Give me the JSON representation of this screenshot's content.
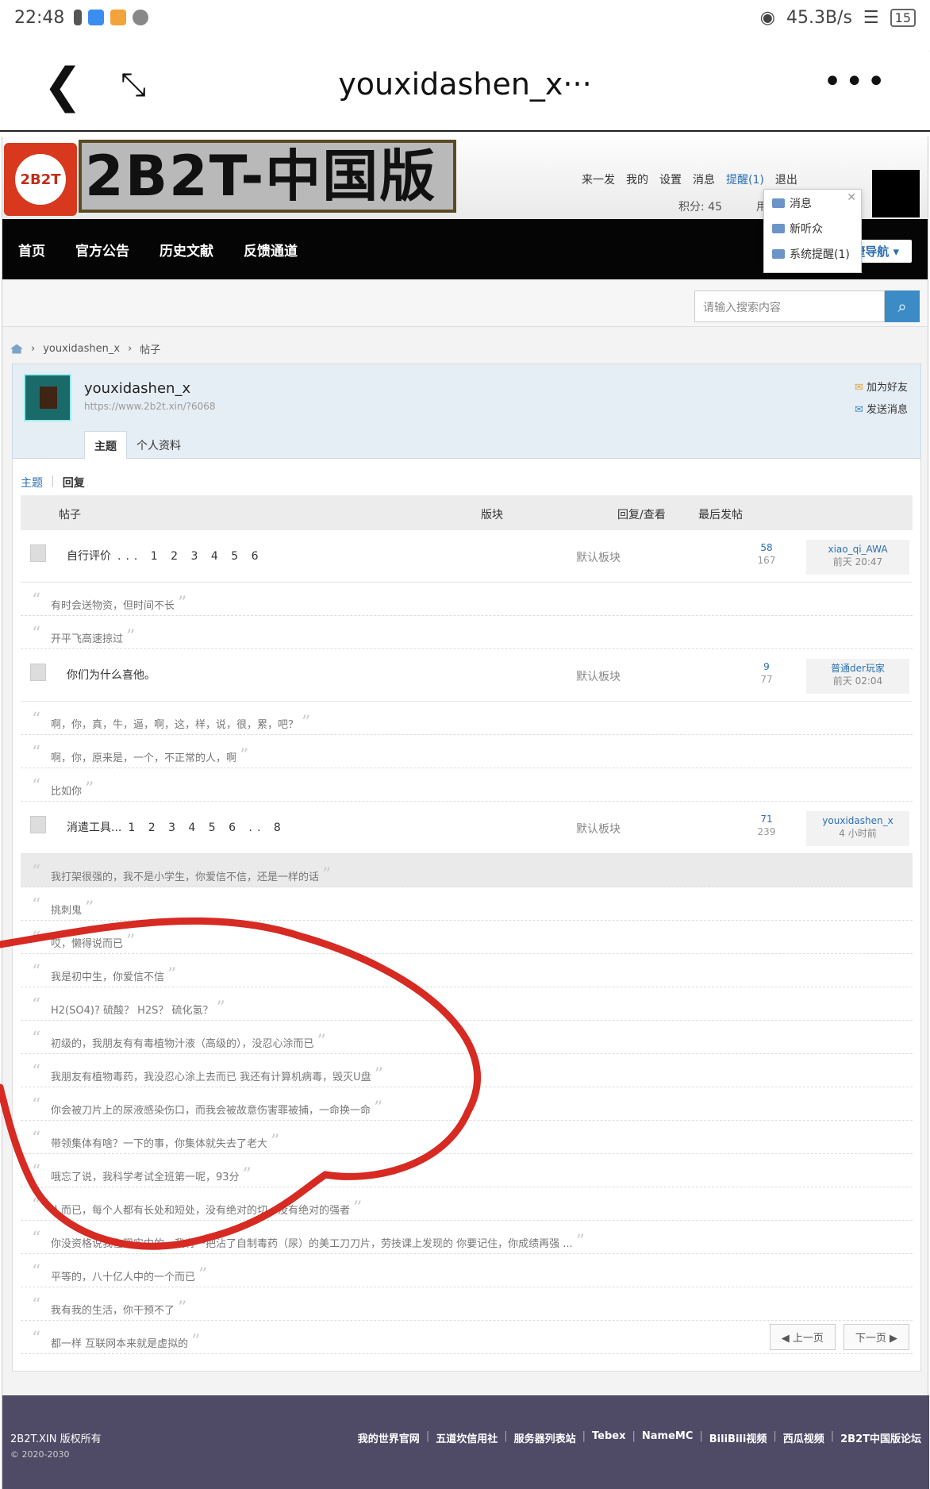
{
  "status": {
    "time": "22:48",
    "speed": "45.3B/s",
    "battery": "15"
  },
  "app": {
    "title": "youxidashen_x···"
  },
  "site": {
    "logo_badge": "2B2T",
    "logo_text": "2B2T-中国版",
    "user_links": [
      "来一发",
      "我的",
      "设置",
      "消息",
      "提醒(1)",
      "退出"
    ],
    "points": "积分: 45",
    "points_extra": "用"
  },
  "popup": {
    "items": [
      "消息",
      "新听众",
      "系统提醒(1)"
    ]
  },
  "nav": {
    "items": [
      "首页",
      "官方公告",
      "历史文献",
      "反馈通道"
    ],
    "fast_nav": "快捷导航"
  },
  "search": {
    "placeholder": "请输入搜索内容"
  },
  "breadcrumb": {
    "user": "youxidashen_x",
    "page": "帖子"
  },
  "profile": {
    "name": "youxidashen_x",
    "url": "https://www.2b2t.xin/?6068",
    "add_friend": "加为好友",
    "send_msg": "发送消息",
    "tabs": [
      "主题",
      "个人资料"
    ]
  },
  "subtabs": [
    "主题",
    "回复"
  ],
  "table_head": {
    "post": "帖子",
    "forum": "版块",
    "stats": "回复/查看",
    "last": "最后发帖"
  },
  "rows": [
    {
      "kind": "thread",
      "title": "自行评价",
      "pages": "... 1 2 3 4 5 6",
      "forum": "默认板块",
      "replies": "58",
      "views": "167",
      "last_user": "xiao_qi_AWA",
      "last_time": "前天 20:47"
    },
    {
      "kind": "reply",
      "text": "有时会送物资，但时间不长"
    },
    {
      "kind": "reply",
      "text": "开平飞高速掠过"
    },
    {
      "kind": "thread",
      "title": "你们为什么喜他。",
      "pages": "",
      "forum": "默认板块",
      "replies": "9",
      "views": "77",
      "last_user": "普通der玩家",
      "last_time": "前天 02:04"
    },
    {
      "kind": "reply",
      "text": "啊，你，真，牛，逼，啊，这，样，说，很，累，吧？"
    },
    {
      "kind": "reply",
      "text": "啊，你，原来是，一个，不正常的人，啊"
    },
    {
      "kind": "reply",
      "text": "比如你"
    },
    {
      "kind": "thread",
      "title": "消遣工具...",
      "pages": "1 2 3 4 5 6 .. 8",
      "forum": "默认板块",
      "replies": "71",
      "views": "239",
      "last_user": "youxidashen_x",
      "last_time": "4 小时前"
    },
    {
      "kind": "reply",
      "text": "我打架很强的，我不是小学生，你爱信不信，还是一样的话",
      "highlight": true
    },
    {
      "kind": "reply",
      "text": "挑刺鬼"
    },
    {
      "kind": "reply",
      "text": "哎，懒得说而已"
    },
    {
      "kind": "reply",
      "text": "我是初中生，你爱信不信"
    },
    {
      "kind": "reply",
      "text": "H2(SO4)? 硫酸？ H2S？ 硫化氢？"
    },
    {
      "kind": "reply",
      "text": "初级的，我朋友有有毒植物汁液（高级的），没忍心涂而已"
    },
    {
      "kind": "reply",
      "text": "我朋友有植物毒药，我没忍心涂上去而已 我还有计算机病毒，毁灭U盘"
    },
    {
      "kind": "reply",
      "text": "你会被刀片上的尿液感染伤口，而我会被故意伤害罪被捕，一命换一命"
    },
    {
      "kind": "reply",
      "text": "带领集体有啥？一下的事，你集体就失去了老大"
    },
    {
      "kind": "reply",
      "text": "哦忘了说，我科学考试全班第一呢，93分"
    },
    {
      "kind": "reply",
      "text": "人而已，每个人都有长处和短处，没有绝对的切，没有绝对的强者"
    },
    {
      "kind": "reply",
      "text": "你没资格说我在现实中的，我有一把沾了自制毒药（尿）的美工刀刀片，劳技课上发现的 你要记住，你成绩再强 ..."
    },
    {
      "kind": "reply",
      "text": "平等的，八十亿人中的一个而已"
    },
    {
      "kind": "reply",
      "text": "我有我的生活，你干预不了"
    },
    {
      "kind": "reply",
      "text": "都一样 互联网本来就是虚拟的"
    }
  ],
  "pager": {
    "prev": "上一页",
    "next": "下一页"
  },
  "footer": {
    "copyright": "2B2T.XIN 版权所有",
    "year": "© 2020-2030",
    "links": [
      "我的世界官网",
      "五道坎信用社",
      "服务器列表站",
      "Tebex",
      "NameMC",
      "BiliBili视频",
      "西瓜视频",
      "2B2T中国版论坛"
    ]
  },
  "colors": {
    "accent": "#2b6fb3",
    "nav_bg": "#050505",
    "footer_bg": "#4f4a66",
    "logo_red": "#d8391e",
    "scribble": "#d62a22"
  }
}
